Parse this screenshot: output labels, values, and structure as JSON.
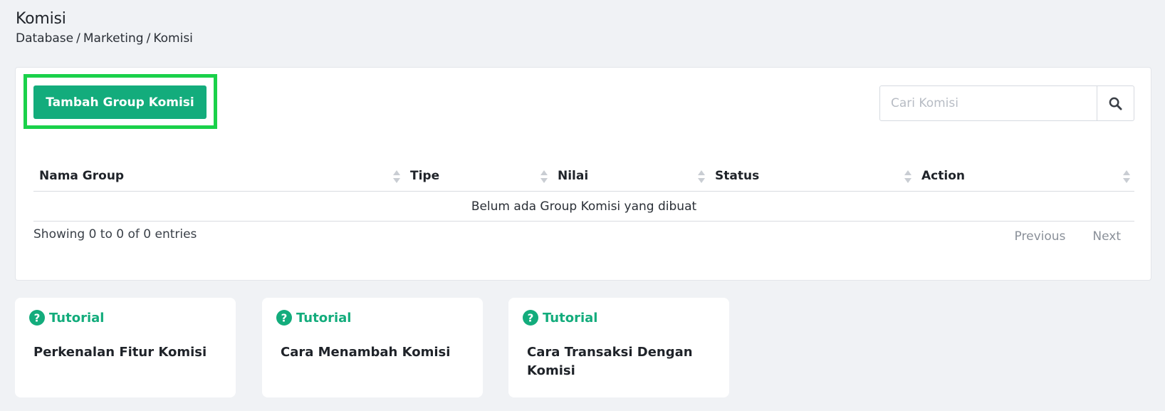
{
  "page": {
    "title": "Komisi",
    "breadcrumb": [
      "Database",
      "Marketing",
      "Komisi"
    ]
  },
  "toolbar": {
    "add_button_label": "Tambah Group Komisi",
    "search_placeholder": "Cari Komisi",
    "search_value": ""
  },
  "table": {
    "columns": [
      "Nama Group",
      "Tipe",
      "Nilai",
      "Status",
      "Action"
    ],
    "rows": [],
    "empty_message": "Belum ada Group Komisi yang dibuat",
    "info": "Showing 0 to 0 of 0 entries",
    "pagination": {
      "previous": "Previous",
      "next": "Next"
    }
  },
  "tutorials": [
    {
      "label": "Tutorial",
      "title": "Perkenalan Fitur Komisi"
    },
    {
      "label": "Tutorial",
      "title": "Cara Menambah Komisi"
    },
    {
      "label": "Tutorial",
      "title": "Cara Transaksi Dengan Komisi"
    }
  ],
  "colors": {
    "accent": "#13ac7c",
    "highlight": "#1ad14a",
    "background": "#f0f2f5"
  }
}
